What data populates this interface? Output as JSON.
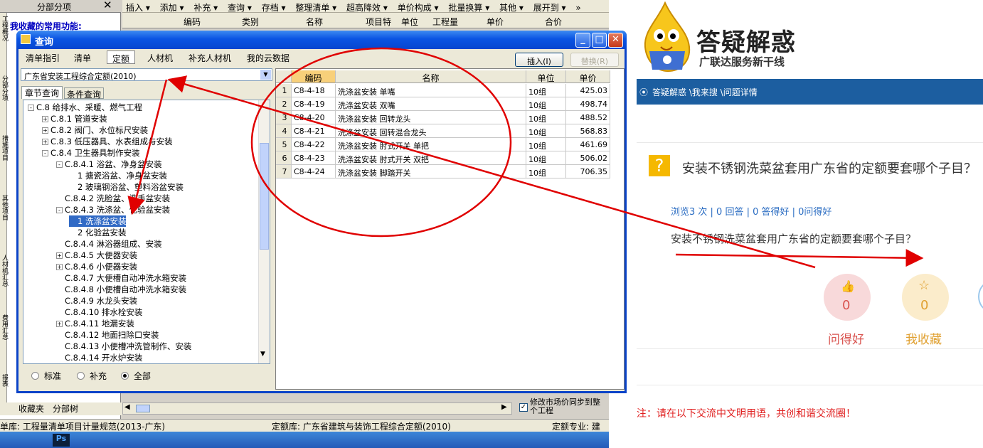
{
  "app": {
    "left_panel_title": "分部分项",
    "favorites_label": "我收藏的常用功能:",
    "toolbar_items": [
      "插入 ▾",
      "添加 ▾",
      "补充 ▾",
      "查询 ▾",
      "存档 ▾",
      "整理清单 ▾",
      "超高降效 ▾",
      "单价构成 ▾",
      "批量换算 ▾",
      "其他 ▾",
      "展开到 ▾",
      "»"
    ],
    "grid_columns": [
      "编码",
      "类别",
      "名称",
      "项目特",
      "单位",
      "工程量",
      "单价",
      "合价"
    ],
    "vertical_tabs": [
      "工程概况",
      "分部分项",
      "措施项目",
      "其他项目",
      "人材机汇总",
      "费用汇总",
      "报表"
    ],
    "bottom_tabs": [
      "收藏夹",
      "分部树"
    ],
    "sync_checkbox_label": "修改市场价同步到整个工程",
    "status": {
      "left": "单库:  工程量清单项目计量规范(2013-广东)",
      "middle": "定额库:  广东省建筑与装饰工程综合定额(2010)",
      "right": "定额专业:  建"
    },
    "taskbar_ps": "Ps"
  },
  "dialog": {
    "title": "查询",
    "tabs": [
      "清单指引",
      "清单",
      "定额",
      "人材机",
      "补充人材机",
      "我的云数据"
    ],
    "selected_tab": "定额",
    "insert_button": "插入(I)",
    "replace_button": "替换(R)",
    "library_value": "广东省安装工程综合定额(2010)",
    "subtabs": [
      "章节查询",
      "条件查询"
    ],
    "tree": [
      {
        "text": "C.8 给排水、采暖、燃气工程",
        "indent": 0,
        "toggle": "-"
      },
      {
        "text": "C.8.1 管道安装",
        "indent": 1,
        "toggle": "+"
      },
      {
        "text": "C.8.2 阀门、水位标尺安装",
        "indent": 1,
        "toggle": "+"
      },
      {
        "text": "C.8.3 低压器具、水表组成与安装",
        "indent": 1,
        "toggle": "+"
      },
      {
        "text": "C.8.4 卫生器具制作安装",
        "indent": 1,
        "toggle": "-"
      },
      {
        "text": "C.8.4.1 浴盆、净身盆安装",
        "indent": 2,
        "toggle": "-"
      },
      {
        "text": "1 搪瓷浴盆、净身盆安装",
        "indent": 3,
        "toggle": ""
      },
      {
        "text": "2 玻璃钢浴盆、塑料浴盆安装",
        "indent": 3,
        "toggle": ""
      },
      {
        "text": "C.8.4.2 洗脸盆、洗手盆安装",
        "indent": 2,
        "toggle": ""
      },
      {
        "text": "C.8.4.3 洗涤盆、化验盆安装",
        "indent": 2,
        "toggle": "-"
      },
      {
        "text": "1 洗涤盆安装",
        "indent": 3,
        "toggle": "",
        "selected": true
      },
      {
        "text": "2 化验盆安装",
        "indent": 3,
        "toggle": ""
      },
      {
        "text": "C.8.4.4 淋浴器组成、安装",
        "indent": 2,
        "toggle": ""
      },
      {
        "text": "C.8.4.5 大便器安装",
        "indent": 2,
        "toggle": "+"
      },
      {
        "text": "C.8.4.6 小便器安装",
        "indent": 2,
        "toggle": "+"
      },
      {
        "text": "C.8.4.7 大便槽自动冲洗水箱安装",
        "indent": 2,
        "toggle": ""
      },
      {
        "text": "C.8.4.8 小便槽自动冲洗水箱安装",
        "indent": 2,
        "toggle": ""
      },
      {
        "text": "C.8.4.9 水龙头安装",
        "indent": 2,
        "toggle": ""
      },
      {
        "text": "C.8.4.10 排水栓安装",
        "indent": 2,
        "toggle": ""
      },
      {
        "text": "C.8.4.11 地漏安装",
        "indent": 2,
        "toggle": "+"
      },
      {
        "text": "C.8.4.12 地面扫除口安装",
        "indent": 2,
        "toggle": ""
      },
      {
        "text": "C.8.4.13 小便槽冲洗管制作、安装",
        "indent": 2,
        "toggle": ""
      },
      {
        "text": "C.8.4.14 开水炉安装",
        "indent": 2,
        "toggle": ""
      }
    ],
    "filters": [
      "标准",
      "补充",
      "全部"
    ],
    "selected_filter": "全部",
    "grid_headers": [
      "编码",
      "名称",
      "单位",
      "单价"
    ],
    "rows": [
      {
        "no": "1",
        "code": "C8-4-18",
        "name": "洗涤盆安装 单嘴",
        "unit": "10组",
        "price": "425.03"
      },
      {
        "no": "2",
        "code": "C8-4-19",
        "name": "洗涤盆安装 双嘴",
        "unit": "10组",
        "price": "498.74"
      },
      {
        "no": "3",
        "code": "C8-4-20",
        "name": "洗涤盆安装 回转龙头",
        "unit": "10组",
        "price": "488.52"
      },
      {
        "no": "4",
        "code": "C8-4-21",
        "name": "洗涤盆安装 回转混合龙头",
        "unit": "10组",
        "price": "568.83"
      },
      {
        "no": "5",
        "code": "C8-4-22",
        "name": "洗涤盆安装 肘式开关 单把",
        "unit": "10组",
        "price": "461.69"
      },
      {
        "no": "6",
        "code": "C8-4-23",
        "name": "洗涤盆安装 肘式开关 双把",
        "unit": "10组",
        "price": "506.02"
      },
      {
        "no": "7",
        "code": "C8-4-24",
        "name": "洗涤盆安装 脚踏开关",
        "unit": "10组",
        "price": "706.35"
      }
    ]
  },
  "web": {
    "brand_title": "答疑解惑",
    "brand_subtitle": "广联达服务新干线",
    "breadcrumb": "答疑解惑 \\我来搜 \\问题详情",
    "question_title": "安装不锈钢洗菜盆套用广东省的定额要套哪个子目？",
    "stats": "浏览3 次 | 0 回答 | 0 答得好 | 0问得好",
    "question_body": "安装不锈钢洗菜盆套用广东省的定额要套哪个子目？",
    "like_count": "0",
    "like_label": "问得好",
    "fav_count": "0",
    "fav_label": "我收藏",
    "notice": "注：请在以下交流中文明用语，共创和谐交流圈！",
    "colors": {
      "brand_blue": "#1c5ea0",
      "question_yellow": "#f5b800",
      "like_pink": "#f8d9da",
      "fav_cream": "#fbeccb",
      "annotation_red": "#e00000"
    }
  }
}
